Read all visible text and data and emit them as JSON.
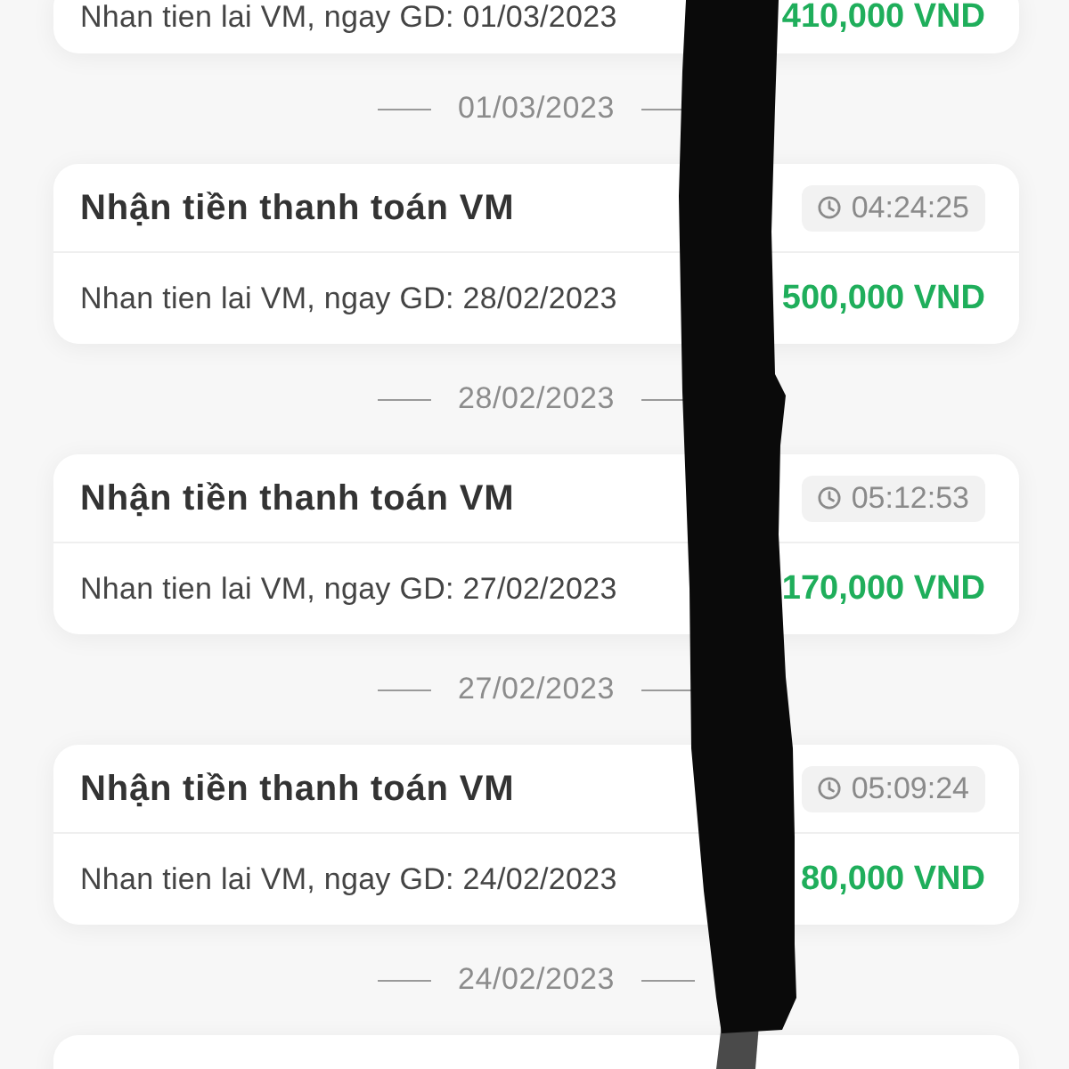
{
  "feed": [
    {
      "kind": "transaction",
      "description": "Nhan tien lai VM, ngay GD: 01/03/2023",
      "amount": "410,000 VND"
    },
    {
      "kind": "date_separator",
      "label": "01/03/2023"
    },
    {
      "kind": "transaction",
      "title": "Nhận tiền thanh toán VM",
      "time": "04:24:25",
      "description": "Nhan tien lai VM, ngay GD: 28/02/2023",
      "amount": "500,000 VND"
    },
    {
      "kind": "date_separator",
      "label": "28/02/2023"
    },
    {
      "kind": "transaction",
      "title": "Nhận tiền thanh toán VM",
      "time": "05:12:53",
      "description": "Nhan tien lai VM, ngay GD: 27/02/2023",
      "amount": "170,000 VND"
    },
    {
      "kind": "date_separator",
      "label": "27/02/2023"
    },
    {
      "kind": "transaction",
      "title": "Nhận tiền thanh toán VM",
      "time": "05:09:24",
      "description": "Nhan tien lai VM, ngay GD: 24/02/2023",
      "amount": "80,000 VND"
    },
    {
      "kind": "date_separator",
      "label": "24/02/2023"
    },
    {
      "kind": "transaction"
    }
  ]
}
